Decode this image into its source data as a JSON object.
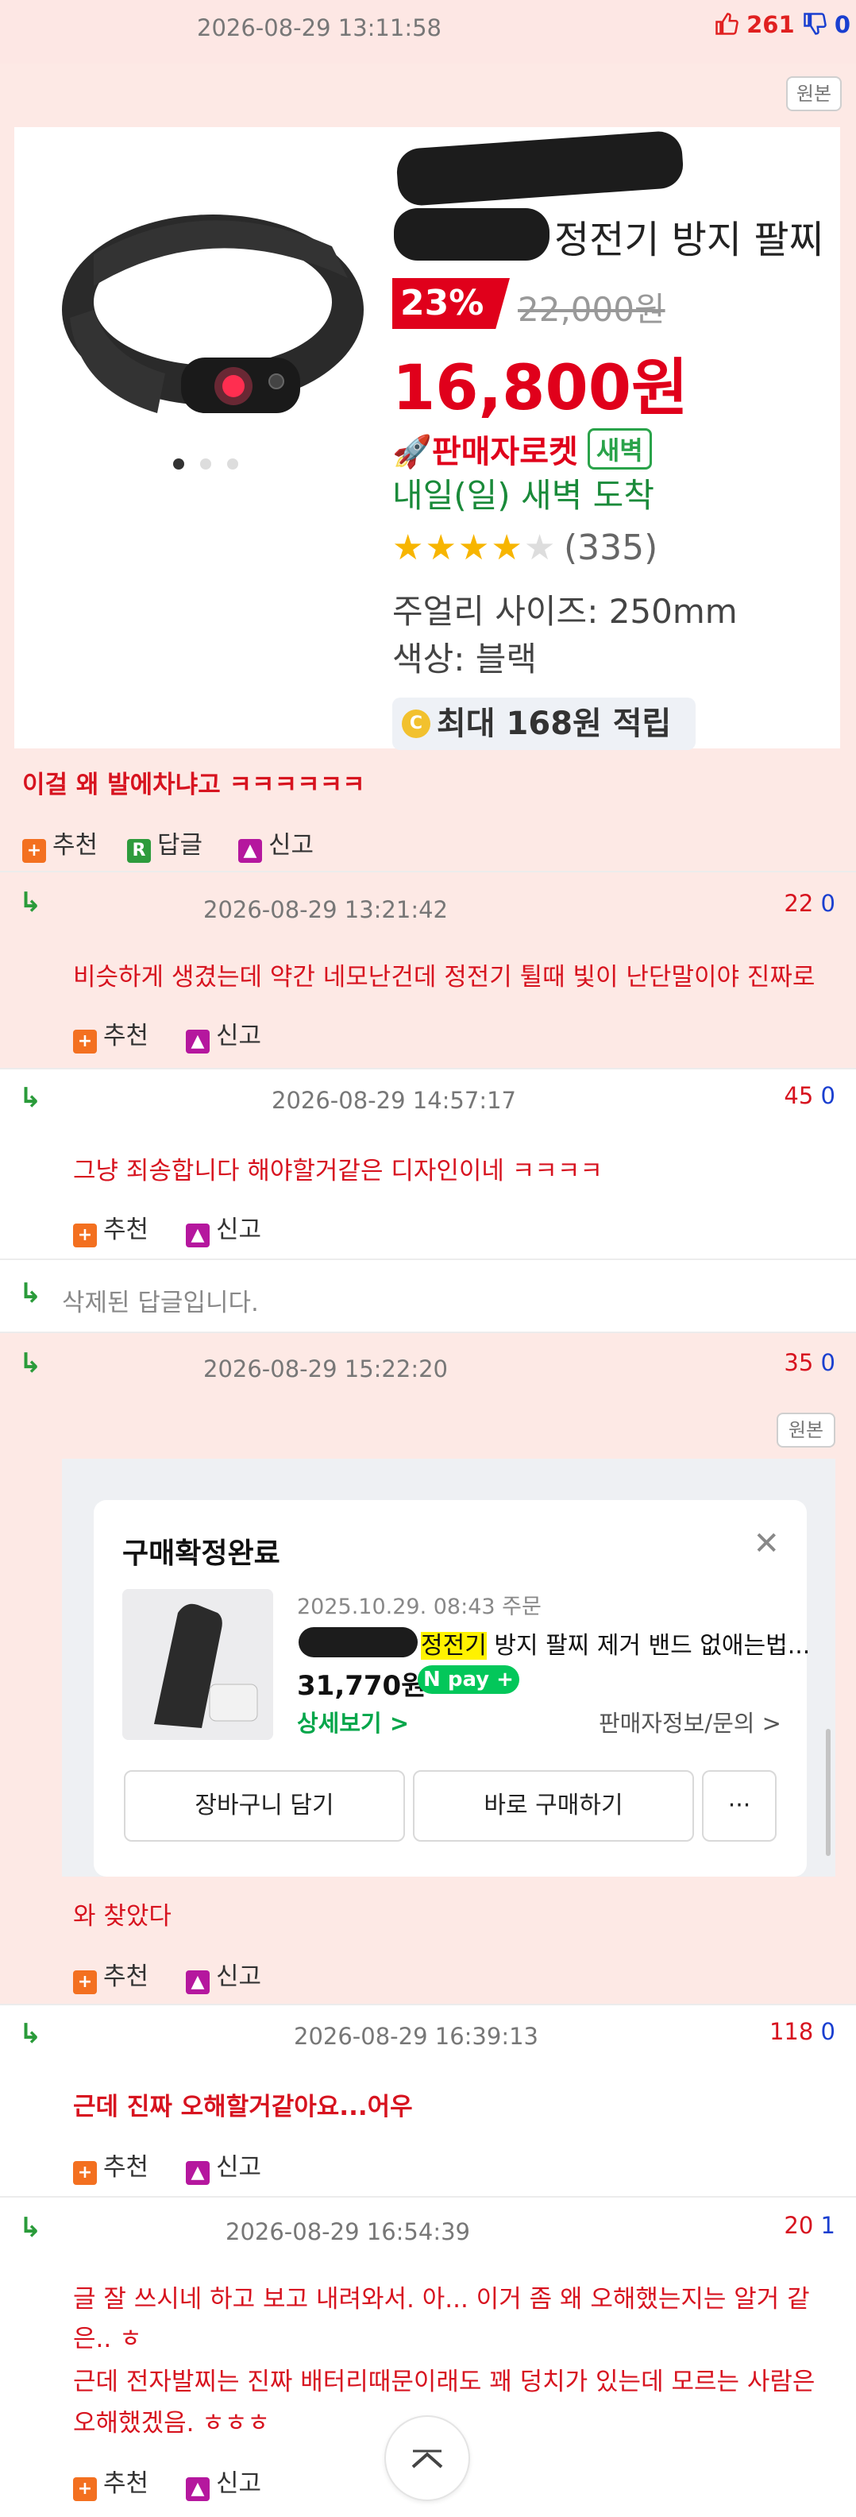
{
  "post": {
    "datetime": "2026-08-29 13:11:58",
    "likes": "261",
    "dislikes": "0",
    "original_label": "원본",
    "product": {
      "title_visible": "정전기 방지 팔찌",
      "discount": "23%",
      "original_price": "22,000원",
      "price": "16,800원",
      "rocket_label": "판매자로켓",
      "dawn_badge": "새벽",
      "delivery": "내일(일) 새벽 도착",
      "rating": 4,
      "reviews": "(335)",
      "size_label": "주얼리 사이즈:",
      "size_value": "250mm",
      "color_label": "색상:",
      "color_value": "블랙",
      "reward_icon": "C",
      "reward": "최대 168원 적립"
    },
    "text": "이걸 왜 발에차냐고 ㅋㅋㅋㅋㅋㅋ",
    "actions": {
      "recommend": "추천",
      "reply": "답글",
      "report": "신고"
    }
  },
  "replies": [
    {
      "datetime": "2026-08-29 13:21:42",
      "likes": "22",
      "dislikes": "0",
      "text": "비슷하게 생겼는데 약간 네모난건데 정전기 튈때 빛이 난단말이야 진짜로",
      "bold": false
    },
    {
      "datetime": "2026-08-29 14:57:17",
      "likes": "45",
      "dislikes": "0",
      "text": "그냥 죄송합니다 해야할거같은 디자인이네 ㅋㅋㅋㅋ",
      "bold": false
    },
    {
      "deleted": "삭제된 답글입니다."
    },
    {
      "datetime": "2026-08-29 15:22:20",
      "likes": "35",
      "dislikes": "0",
      "text": "와 찾았다",
      "bold": false,
      "original_label": "원본",
      "purchase": {
        "header": "구매확정완료",
        "order_date": "2025.10.29. 08:43 주문",
        "name_highlight": "정전기",
        "name_rest": " 방지 팔찌 제거 밴드 없애는법...",
        "price": "31,770원",
        "npay": "N pay +",
        "detail": "상세보기 >",
        "seller": "판매자정보/문의 >",
        "cart_button": "장바구니 담기",
        "buy_button": "바로 구매하기",
        "more_button": "···"
      }
    },
    {
      "datetime": "2026-08-29 16:39:13",
      "likes": "118",
      "dislikes": "0",
      "text": "근데 진짜 오해할거같아요...어우",
      "bold": true
    },
    {
      "datetime": "2026-08-29 16:54:39",
      "likes": "20",
      "dislikes": "1",
      "text_line1": "글 잘 쓰시네 하고 보고 내려와서. 아... 이거 좀 왜 오해했는지는 알거 같",
      "text_line2": "은.. ㅎ",
      "text_line3": "근데 전자발찌는 진짜 배터리때문이래도 꽤 덩치가 있는데 모르는 사람은",
      "text_line4": "오해했겠음. ㅎㅎㅎ"
    }
  ],
  "reply_arrow": "↳",
  "scroll_top_icon": "chevron-up-icon"
}
